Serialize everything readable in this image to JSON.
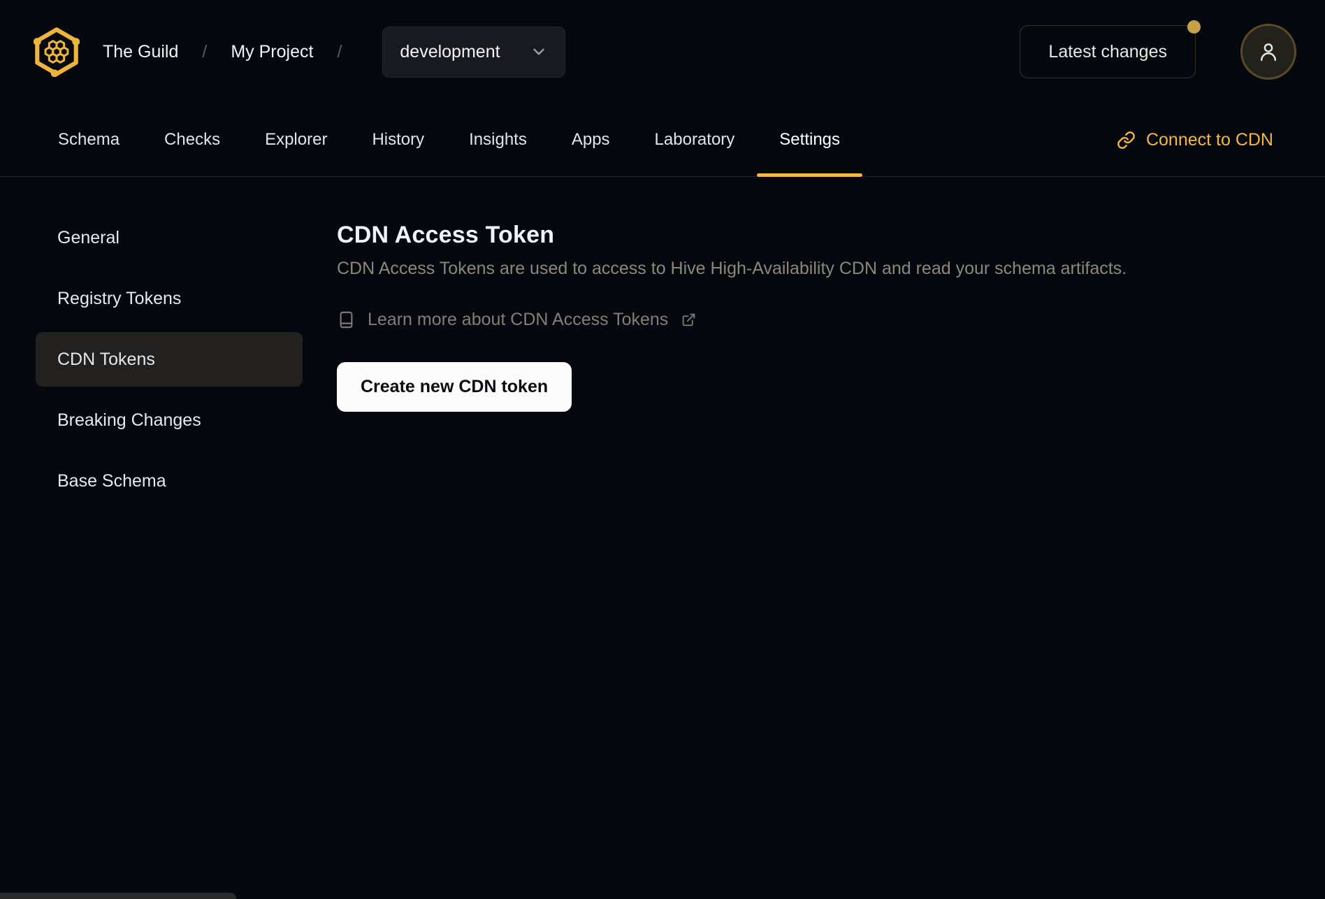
{
  "header": {
    "logo_icon": "hive-honeycomb-logo",
    "breadcrumb": {
      "org": "The Guild",
      "separator": "/",
      "project": "My Project"
    },
    "environment_selector": {
      "value": "development",
      "chevron_icon": "chevron-down-icon"
    },
    "latest_changes": {
      "label": "Latest changes",
      "has_notification_dot": true
    },
    "avatar_icon": "user-icon"
  },
  "tabs": {
    "items": [
      {
        "label": "Schema",
        "active": false
      },
      {
        "label": "Checks",
        "active": false
      },
      {
        "label": "Explorer",
        "active": false
      },
      {
        "label": "History",
        "active": false
      },
      {
        "label": "Insights",
        "active": false
      },
      {
        "label": "Apps",
        "active": false
      },
      {
        "label": "Laboratory",
        "active": false
      },
      {
        "label": "Settings",
        "active": true
      }
    ],
    "connect_cdn": {
      "label": "Connect to CDN",
      "icon": "link-icon"
    }
  },
  "sidebar": {
    "items": [
      {
        "label": "General",
        "active": false
      },
      {
        "label": "Registry Tokens",
        "active": false
      },
      {
        "label": "CDN Tokens",
        "active": true
      },
      {
        "label": "Breaking Changes",
        "active": false
      },
      {
        "label": "Base Schema",
        "active": false
      }
    ]
  },
  "main": {
    "title": "CDN Access Token",
    "description": "CDN Access Tokens are used to access to Hive High-Availability CDN and read your schema artifacts.",
    "learn_more": {
      "label": "Learn more about CDN Access Tokens",
      "book_icon": "book-icon",
      "external_icon": "external-link-icon"
    },
    "create_button": "Create new CDN token"
  },
  "colors": {
    "accent": "#f4b740",
    "background": "#05080e",
    "notification_dot": "#c7a245",
    "active_sidebar_bg": "#232120",
    "button_bg": "#fcfcfc"
  }
}
